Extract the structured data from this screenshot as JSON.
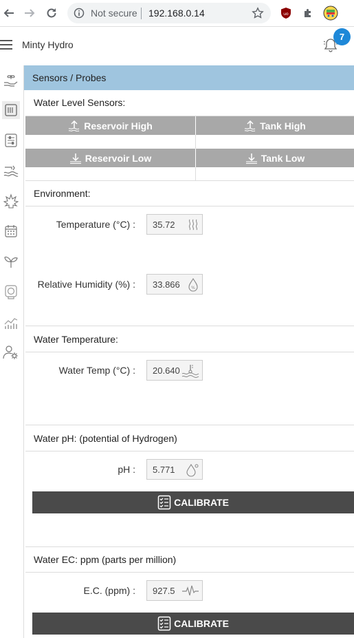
{
  "browser": {
    "security_label": "Not secure",
    "url": "192.168.0.14",
    "icons": [
      "back-arrow-icon",
      "forward-arrow-icon",
      "reload-icon",
      "info-icon",
      "star-icon",
      "ublock-icon",
      "puzzle-icon",
      "profile-avatar"
    ]
  },
  "app": {
    "title": "Minty Hydro",
    "notification_count": "7"
  },
  "sidebar": {
    "items": [
      {
        "name": "plant-hand-icon",
        "active": false
      },
      {
        "name": "sensor-card-icon",
        "active": true
      },
      {
        "name": "control-panel-icon",
        "active": false
      },
      {
        "name": "water-flow-icon",
        "active": false
      },
      {
        "name": "leaf-icon",
        "active": false
      },
      {
        "name": "calendar-icon",
        "active": false
      },
      {
        "name": "sprout-icon",
        "active": false
      },
      {
        "name": "camera-icon",
        "active": false
      },
      {
        "name": "stats-chart-icon",
        "active": false
      },
      {
        "name": "user-settings-icon",
        "active": false
      }
    ]
  },
  "page": {
    "breadcrumb": "Sensors / Probes",
    "water_level": {
      "title": "Water Level Sensors:",
      "reservoir_high": "Reservoir High",
      "tank_high": "Tank High",
      "reservoir_low": "Reservoir Low",
      "tank_low": "Tank Low"
    },
    "environment": {
      "title": "Environment:",
      "temperature_label": "Temperature (°C) :",
      "temperature_value": "35.72",
      "humidity_label": "Relative Humidity (%) :",
      "humidity_value": "33.866"
    },
    "water_temp": {
      "title": "Water Temperature:",
      "label": "Water Temp (°C) :",
      "value": "20.640"
    },
    "ph": {
      "title": "Water pH: (potential of Hydrogen)",
      "label": "pH :",
      "value": "5.771",
      "calibrate": "CALIBRATE"
    },
    "ec": {
      "title": "Water EC: ppm (parts per million)",
      "label": "E.C. (ppm) :",
      "value": "927.5",
      "calibrate": "CALIBRATE"
    }
  },
  "colors": {
    "header_bg": "#9fc5df",
    "sensor_button": "#a8a8a8",
    "calibrate_button": "#4a4a4a",
    "badge": "#1e88d8"
  }
}
